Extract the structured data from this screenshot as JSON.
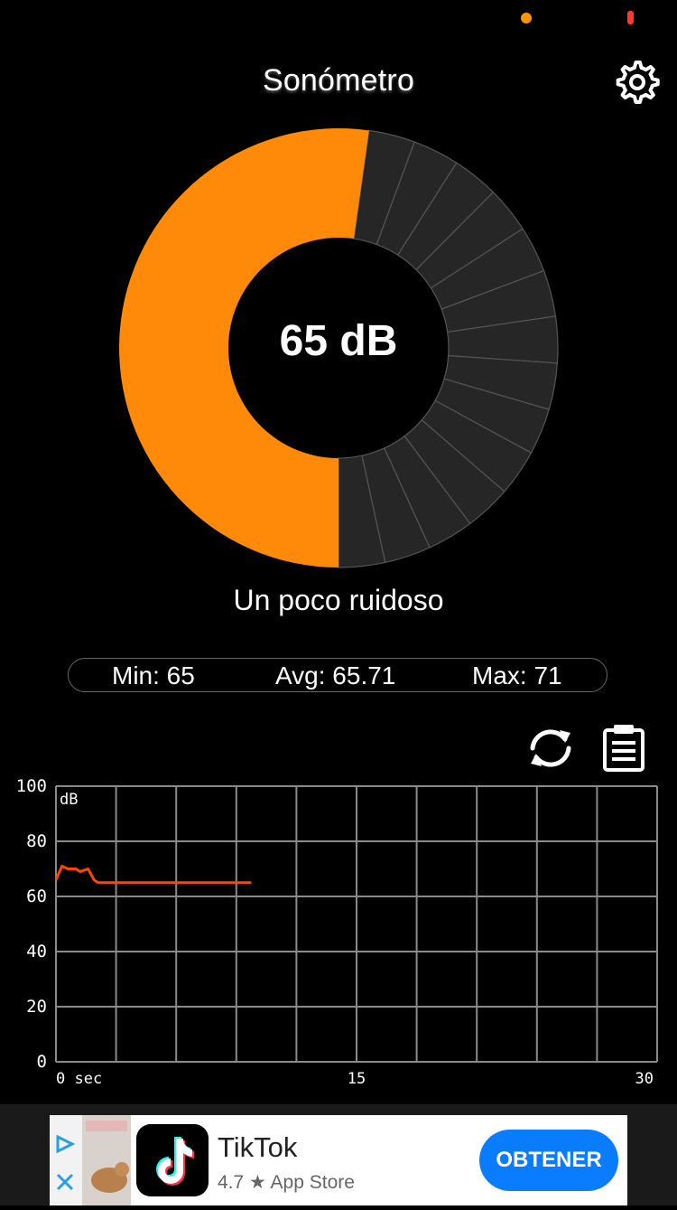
{
  "header": {
    "title": "Sonómetro",
    "settings_icon": "gear-icon"
  },
  "gauge": {
    "readout": "65 dB",
    "level_fraction": 0.5222,
    "segments_total": 30,
    "colors": {
      "active": "#ff8a0a",
      "inactive": "#262626",
      "divider": "#555555"
    }
  },
  "noise_label": "Un poco ruidoso",
  "stats": {
    "min": "Min: 65",
    "avg": "Avg: 65.71",
    "max": "Max: 71"
  },
  "actions": {
    "refresh_icon": "refresh-icon",
    "clipboard_icon": "clipboard-icon"
  },
  "chart_data": {
    "type": "line",
    "ylabel": "dB",
    "ylim": [
      0,
      100
    ],
    "yticks": [
      "0",
      "20",
      "40",
      "60",
      "80",
      "100"
    ],
    "xlim": [
      0,
      30
    ],
    "xticks": [
      {
        "value": 0,
        "label": "0 sec"
      },
      {
        "value": 15,
        "label": "15"
      },
      {
        "value": 30,
        "label": "30"
      }
    ],
    "x_grid_lines": 10,
    "grid": true,
    "series": [
      {
        "color": "#ff4500",
        "x": [
          0,
          0.3,
          0.6,
          1.0,
          1.2,
          1.6,
          1.9,
          2.1,
          2.5,
          4.5,
          7.0,
          9.75
        ],
        "y": [
          66,
          71,
          70,
          70,
          69,
          70,
          66,
          65,
          65,
          65,
          65,
          65
        ]
      }
    ]
  },
  "ad": {
    "app_name": "TikTok",
    "rating": "4.7 ★ App Store",
    "cta": "OBTENER",
    "ad_choices_icon": "adchoices-icon",
    "close_icon": "close-icon",
    "logo_icon": "tiktok-logo-icon"
  }
}
